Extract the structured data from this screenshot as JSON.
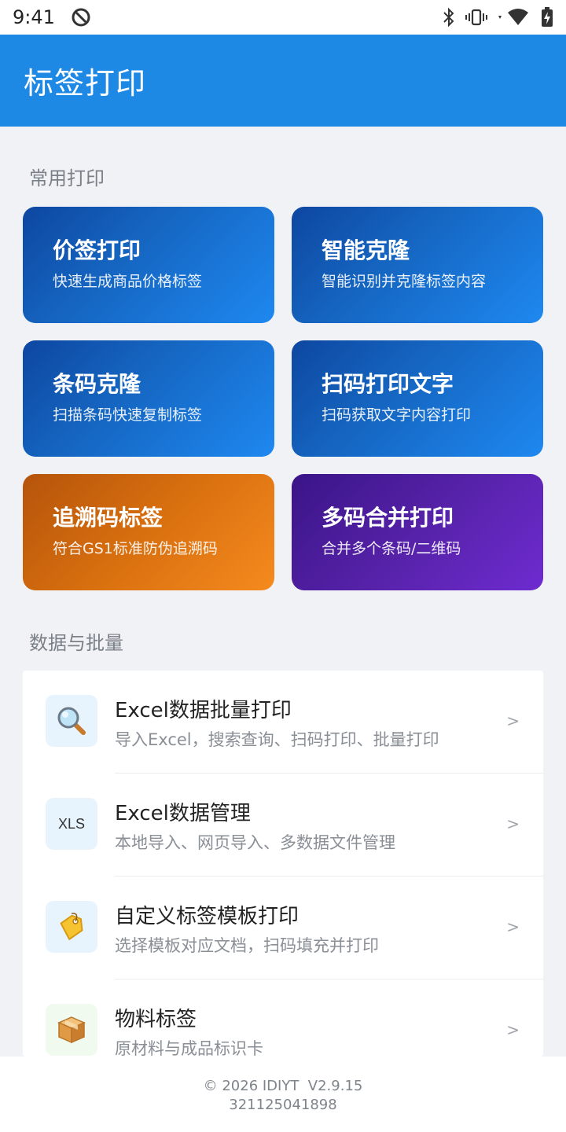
{
  "status_bar": {
    "time": "9:41"
  },
  "app_bar": {
    "title": "标签打印"
  },
  "sections": {
    "common": "常用打印",
    "data": "数据与批量"
  },
  "cards": [
    {
      "title": "价签打印",
      "subtitle": "快速生成商品价格标签"
    },
    {
      "title": "智能克隆",
      "subtitle": "智能识别并克隆标签内容"
    },
    {
      "title": "条码克隆",
      "subtitle": "扫描条码快速复制标签"
    },
    {
      "title": "扫码打印文字",
      "subtitle": "扫码获取文字内容打印"
    },
    {
      "title": "追溯码标签",
      "subtitle": "符合GS1标准防伪追溯码"
    },
    {
      "title": "多码合并打印",
      "subtitle": "合并多个条码/二维码"
    }
  ],
  "colors": {
    "primary": "#1E88E5",
    "card_blue": "#1565C0",
    "card_orange": "#D9700F",
    "card_purple": "#5622A8"
  },
  "list_items": [
    {
      "title": "Excel数据批量打印",
      "subtitle": "导入Excel，搜索查询、扫码打印、批量打印",
      "icon": "magnifier-icon",
      "chevron": ">"
    },
    {
      "title": "Excel数据管理",
      "subtitle": "本地导入、网页导入、多数据文件管理",
      "icon": "xls-icon",
      "icon_text": "XLS",
      "chevron": ">"
    },
    {
      "title": "自定义标签模板打印",
      "subtitle": "选择模板对应文档，扫码填充并打印",
      "icon": "price-tag-icon",
      "chevron": ">"
    },
    {
      "title": "物料标签",
      "subtitle": "原材料与成品标识卡",
      "icon": "package-icon",
      "chevron": ">"
    }
  ],
  "footer": {
    "copyright": "© 2026 IDIYT  V2.9.15",
    "id": "321125041898"
  }
}
